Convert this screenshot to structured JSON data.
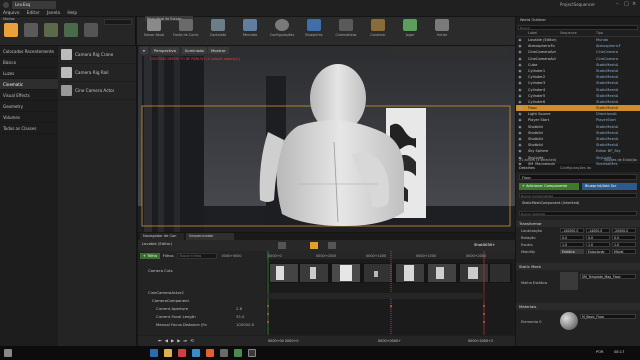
{
  "window": {
    "title": "ProjectSequencer"
  },
  "menu": [
    "Arquivo",
    "Editar",
    "Janela",
    "Help"
  ],
  "level_tab": "Lev.Esq",
  "modes_tab": "Modos",
  "place": {
    "categories": [
      "Colocados Recentemente",
      "Básico",
      "Luzes",
      "Cinematic",
      "Visual Effects",
      "Geometry",
      "Volumes",
      "Todos as Classes"
    ],
    "selected": "Cinematic",
    "items": [
      "Camera Rig Crane",
      "Camera Rig Rail",
      "Cine Camera Actor"
    ]
  },
  "toolbar": {
    "tab": "Nível Atual do Escopo",
    "buttons": [
      "Salvar Atual",
      "Fonte de Contr.",
      "Conteúdo",
      "Mercado",
      "Configurações",
      "Blueprints",
      "Cinemáticas",
      "Construir",
      "Jogar",
      "Iniciar"
    ]
  },
  "viewport": {
    "pills": [
      "Perspectiva",
      "Iluminado",
      "Mostrar"
    ],
    "warning": "LIGHTING NEEDS TO BE REBUILT (4 unbuilt object(s))"
  },
  "sequencer": {
    "tabs": [
      "Navegador de Con",
      "Sequenciador"
    ],
    "sequence_name": "Lovable (Editor)",
    "track_button": "+ Trilha",
    "filter_button": "Filtros",
    "search_placeholder": "Buscar trilhas",
    "timecode": "0000+0000",
    "current_time": "Shot0050+",
    "tracks": [
      {
        "label": "Camera Cuts",
        "indent": 1
      },
      {
        "label": "CineCameraActor2",
        "indent": 1
      },
      {
        "label": "CameraComponent",
        "indent": 2
      },
      {
        "label": "Current Aperture",
        "indent": 3,
        "value": "2.8"
      },
      {
        "label": "Current Focal Length",
        "indent": 3,
        "value": "35.0"
      },
      {
        "label": "Manual Focus Distance (Fo",
        "indent": 3,
        "value": "100000.0"
      }
    ],
    "ruler_labels": [
      "0000+0",
      "0000+0500",
      "0000+1000",
      "0000+1500",
      "0000+2000"
    ],
    "bottom_readouts": [
      "0000+00 0000+0",
      "0000+0000+",
      "0000+2000+2"
    ]
  },
  "outliner": {
    "tab": "World Outliner",
    "search_placeholder": "Buscar",
    "col_label": "Label",
    "col_type": "Tipo",
    "col_sequence": "Sequence",
    "rows": [
      {
        "name": "Lovable (Editor)",
        "type": "Mundo"
      },
      {
        "name": "AtmosphericFo",
        "type": "AtmosphericF"
      },
      {
        "name": "CineCameraAct",
        "type": "CineCamera"
      },
      {
        "name": "CineCameraAct",
        "type": "CineCamera"
      },
      {
        "name": "Cube",
        "type": "StaticMeshA"
      },
      {
        "name": "Cylinder1",
        "type": "StaticMeshA"
      },
      {
        "name": "Cylinder2",
        "type": "StaticMeshA"
      },
      {
        "name": "Cylinder3",
        "type": "StaticMeshA"
      },
      {
        "name": "Cylinder4",
        "type": "StaticMeshA"
      },
      {
        "name": "Cylinder5",
        "type": "StaticMeshA"
      },
      {
        "name": "Cylinder6",
        "type": "StaticMeshA"
      },
      {
        "name": "Floor",
        "type": "StaticMeshA",
        "selected": true
      },
      {
        "name": "Light Source",
        "type": "DirectionalL"
      },
      {
        "name": "Player Start",
        "type": "PlayerStart"
      },
      {
        "name": "Shotbild",
        "type": "StaticMeshA"
      },
      {
        "name": "Shotbild",
        "type": "StaticMeshA"
      },
      {
        "name": "Shotbild",
        "type": "StaticMeshA"
      },
      {
        "name": "Shotbild",
        "type": "StaticMeshA"
      },
      {
        "name": "Sky Sphere",
        "type": "Editar BP_Sky"
      },
      {
        "name": "SkyLight",
        "type": "SkyLight"
      },
      {
        "name": "SM_Mannequin",
        "type": "SkeletalMes"
      }
    ],
    "footer": "21 actors (1 selected)",
    "view_options": "Opções de Exibição"
  },
  "details": {
    "tabs": [
      "Detalhes",
      "Configurações do"
    ],
    "actor_name": "Floor",
    "add_component": "+ Adicionar Componente",
    "blueprint": "Blueprint/Add Scr",
    "search_placeholder": "Buscar Componentes",
    "component": "StaticMeshComponent (Inherited)",
    "search_details_placeholder": "Buscar detalhes",
    "transform_section": "Transformar",
    "location_label": "Localização",
    "rotation_label": "Rotação",
    "scale_label": "Escala",
    "mobility_label": "Mobility",
    "location": [
      "-140000.0",
      "-14000.0",
      "-20000.0"
    ],
    "rotation": [
      "0.0",
      "0.0",
      "0.0"
    ],
    "scale": [
      "1.0",
      "1.0",
      "1.0"
    ],
    "mobility_options": [
      "Estático",
      "Estacionár",
      "Móvel"
    ],
    "static_mesh_section": "Static Mesh",
    "static_mesh_label": "Malha Estática",
    "static_mesh_value": "SM_Template_Map_Floor",
    "materials_section": "Materiais",
    "element_label": "Elemento 0",
    "material_value": "M_Basic_Floor"
  },
  "taskbar": {
    "time": "08:17",
    "lang": "POR"
  }
}
